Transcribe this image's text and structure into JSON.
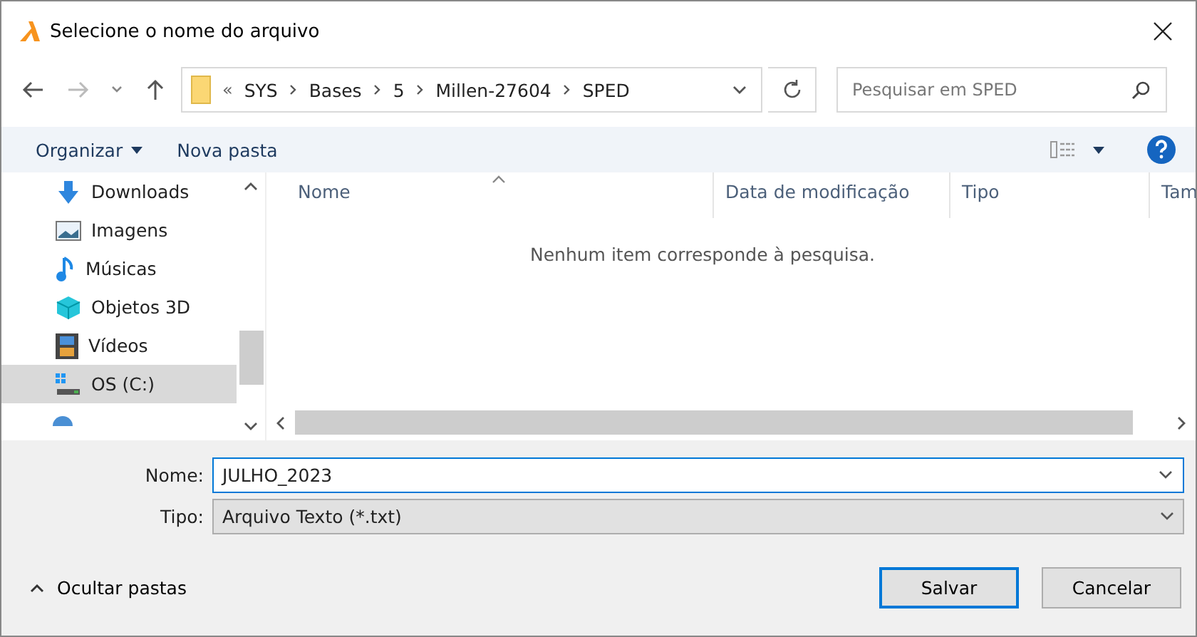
{
  "window": {
    "title": "Selecione o nome do arquivo"
  },
  "breadcrumb": {
    "overflow": "«",
    "segments": [
      "SYS",
      "Bases",
      "5",
      "Millen-27604",
      "SPED"
    ]
  },
  "search": {
    "placeholder": "Pesquisar em SPED"
  },
  "toolbar": {
    "organize": "Organizar",
    "new_folder": "Nova pasta"
  },
  "sidebar": {
    "items": [
      {
        "label": "Downloads",
        "kind": "downloads",
        "selected": false
      },
      {
        "label": "Imagens",
        "kind": "pictures",
        "selected": false
      },
      {
        "label": "Músicas",
        "kind": "music",
        "selected": false
      },
      {
        "label": "Objetos 3D",
        "kind": "objects3d",
        "selected": false
      },
      {
        "label": "Vídeos",
        "kind": "videos",
        "selected": false
      },
      {
        "label": "OS (C:)",
        "kind": "drive",
        "selected": true
      }
    ]
  },
  "table": {
    "columns": [
      "Nome",
      "Data de modificação",
      "Tipo",
      "Tam"
    ],
    "empty_message": "Nenhum item corresponde à pesquisa."
  },
  "form": {
    "name_label": "Nome:",
    "name_value": "JULHO_2023",
    "type_label": "Tipo:",
    "type_value": "Arquivo Texto (*.txt)"
  },
  "footer": {
    "toggle": "Ocultar pastas",
    "buttons": [
      "Salvar",
      "Cancelar"
    ]
  }
}
